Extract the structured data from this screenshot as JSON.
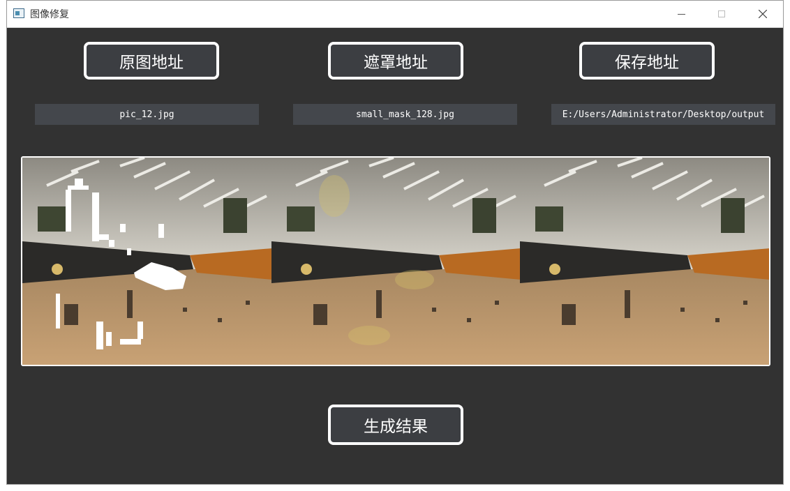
{
  "window": {
    "title": "图像修复"
  },
  "buttons": {
    "original_path": "原图地址",
    "mask_path": "遮罩地址",
    "save_path": "保存地址",
    "generate": "生成结果"
  },
  "fields": {
    "original_value": "pic_12.jpg",
    "mask_value": "small_mask_128.jpg",
    "save_value": "E:/Users/Administrator/Desktop/output"
  },
  "icons": {
    "app": "image-icon",
    "minimize": "minimize-icon",
    "maximize": "maximize-icon",
    "close": "close-icon"
  },
  "colors": {
    "background": "#323232",
    "button_bg": "#3c3e42",
    "button_border": "#ffffff",
    "field_bg": "#44474c"
  }
}
